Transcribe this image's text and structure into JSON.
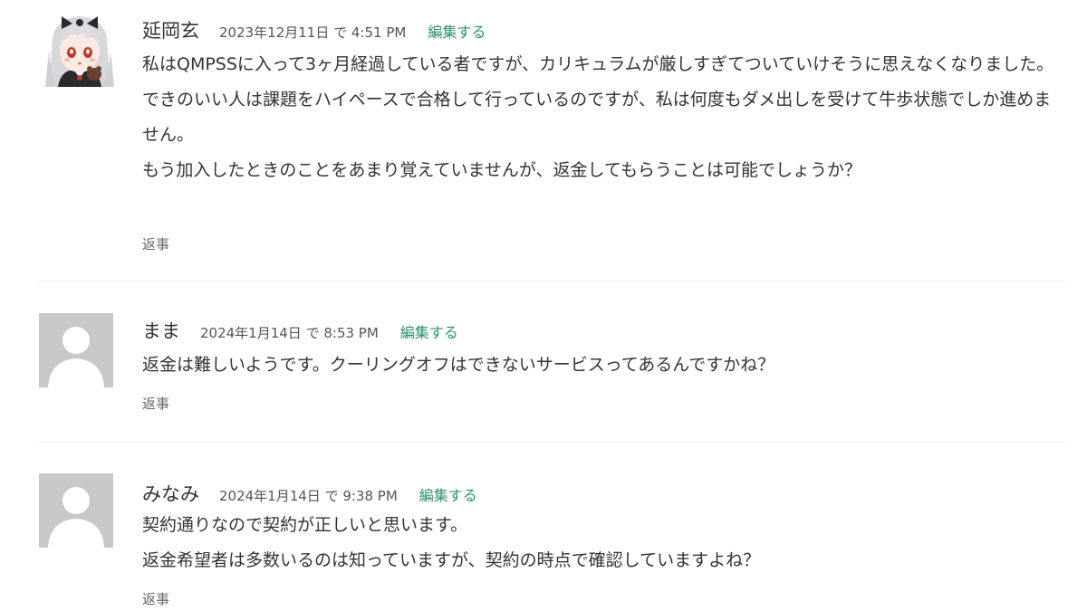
{
  "comments": [
    {
      "author": "延岡玄",
      "date": "2023年12月11日 で 4:51 PM",
      "edit_label": "編集する",
      "lines": [
        "私はQMPSSに入って3ヶ月経過している者ですが、カリキュラムが厳しすぎてついていけそうに思えなくなりました。",
        "できのいい人は課題をハイペースで合格して行っているのですが、私は何度もダメ出しを受けて牛歩状態でしか進めません。",
        "もう加入したときのことをあまり覚えていませんが、返金してもらうことは可能でしょうか？"
      ],
      "reply_label": "返事",
      "avatar": "anime-girl-avatar"
    },
    {
      "author": "まま",
      "date": "2024年1月14日 で 8:53 PM",
      "edit_label": "編集する",
      "lines": [
        "返金は難しいようです。クーリングオフはできないサービスってあるんですかね？"
      ],
      "reply_label": "返事",
      "avatar": "default-user-avatar"
    },
    {
      "author": "みなみ",
      "date": "2024年1月14日 で 9:38 PM",
      "edit_label": "編集する",
      "lines": [
        "契約通りなので契約が正しいと思います。",
        "返金希望者は多数いるのは知っていますが、契約の時点で確認していますよね？"
      ],
      "reply_label": "返事",
      "avatar": "default-user-avatar"
    }
  ],
  "colors": {
    "link": "#2e8f6b",
    "text": "#333333",
    "avatar_placeholder": "#c8c8c8"
  }
}
